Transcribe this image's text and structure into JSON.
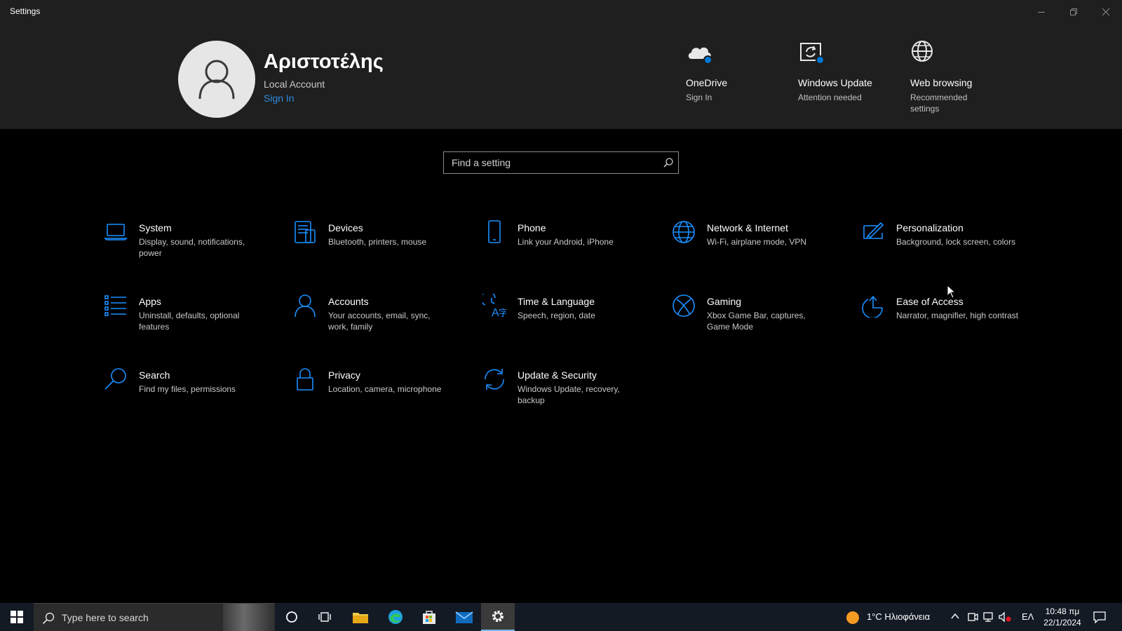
{
  "window": {
    "title": "Settings"
  },
  "profile": {
    "name": "Αριστοτέλης",
    "account_type": "Local Account",
    "sign_in": "Sign In"
  },
  "quick_links": [
    {
      "title": "OneDrive",
      "subtitle": "Sign In",
      "icon": "onedrive-icon",
      "badge": true
    },
    {
      "title": "Windows Update",
      "subtitle": "Attention needed",
      "icon": "windows-update-icon",
      "badge": true
    },
    {
      "title": "Web browsing",
      "subtitle": "Recommended settings",
      "icon": "globe-icon",
      "badge": false
    }
  ],
  "search": {
    "placeholder": "Find a setting"
  },
  "tiles": [
    {
      "title": "System",
      "desc": "Display, sound, notifications, power",
      "icon": "laptop-icon"
    },
    {
      "title": "Devices",
      "desc": "Bluetooth, printers, mouse",
      "icon": "keyboard-icon"
    },
    {
      "title": "Phone",
      "desc": "Link your Android, iPhone",
      "icon": "phone-icon"
    },
    {
      "title": "Network & Internet",
      "desc": "Wi-Fi, airplane mode, VPN",
      "icon": "globe-icon"
    },
    {
      "title": "Personalization",
      "desc": "Background, lock screen, colors",
      "icon": "paint-brush-icon"
    },
    {
      "title": "Apps",
      "desc": "Uninstall, defaults, optional features",
      "icon": "apps-list-icon"
    },
    {
      "title": "Accounts",
      "desc": "Your accounts, email, sync, work, family",
      "icon": "person-icon"
    },
    {
      "title": "Time & Language",
      "desc": "Speech, region, date",
      "icon": "time-language-icon"
    },
    {
      "title": "Gaming",
      "desc": "Xbox Game Bar, captures, Game Mode",
      "icon": "xbox-icon"
    },
    {
      "title": "Ease of Access",
      "desc": "Narrator, magnifier, high contrast",
      "icon": "ease-of-access-icon"
    },
    {
      "title": "Search",
      "desc": "Find my files, permissions",
      "icon": "search-icon"
    },
    {
      "title": "Privacy",
      "desc": "Location, camera, microphone",
      "icon": "lock-icon"
    },
    {
      "title": "Update & Security",
      "desc": "Windows Update, recovery, backup",
      "icon": "refresh-icon"
    }
  ],
  "taskbar": {
    "search_text": "Type here to search",
    "weather": "1°C  Ηλιοφάνεια",
    "language": "ΕΛ",
    "time": "10:48 πμ",
    "date": "22/1/2024"
  },
  "colors": {
    "accent": "#1a8fff",
    "link": "#2d8ae0",
    "header_bg": "#1f1f1f",
    "page_bg": "#000000"
  }
}
